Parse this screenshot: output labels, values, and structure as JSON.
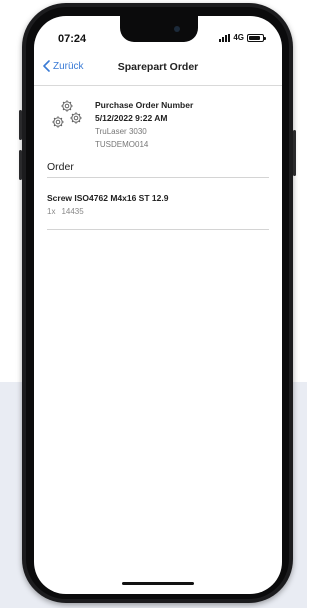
{
  "status_bar": {
    "time": "07:24",
    "network": "4G"
  },
  "nav": {
    "back_label": "Zurück",
    "title": "Sparepart Order"
  },
  "order_header": {
    "icon": "gears-icon",
    "po_label": "Purchase Order Number",
    "date": "5/12/2022 9:22 AM",
    "machine": "TruLaser 3030",
    "reference": "TUSDEMO014"
  },
  "section": {
    "title": "Order"
  },
  "items": [
    {
      "name": "Screw ISO4762 M4x16 ST 12.9",
      "quantity": "1x",
      "part_number": "14435"
    }
  ],
  "colors": {
    "accent": "#3a7bd5",
    "background_block": "#e9ecf3"
  }
}
